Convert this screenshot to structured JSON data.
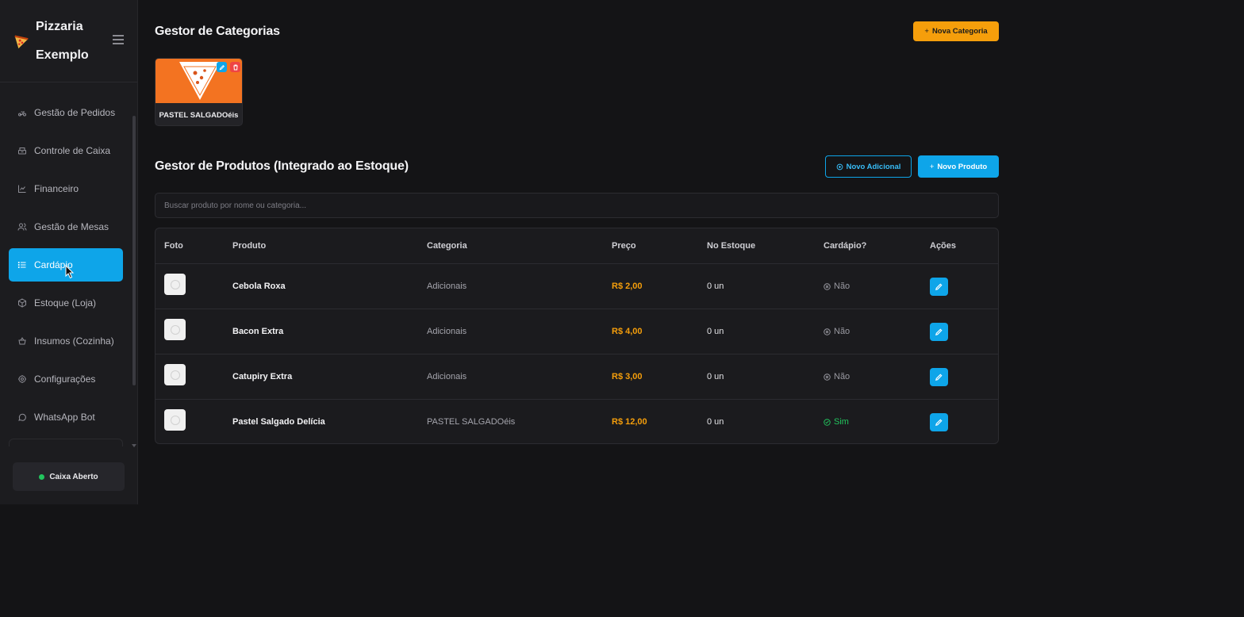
{
  "brand": {
    "name": "Pizzaria Exemplo",
    "logo_icon": "pizza-icon"
  },
  "sidebar": {
    "items": [
      {
        "label": "Gestão de Pedidos",
        "icon": "delivery-icon"
      },
      {
        "label": "Controle de Caixa",
        "icon": "register-icon"
      },
      {
        "label": "Financeiro",
        "icon": "chart-line-icon"
      },
      {
        "label": "Gestão de Mesas",
        "icon": "users-icon"
      },
      {
        "label": "Cardápio",
        "icon": "list-icon",
        "active": true
      },
      {
        "label": "Estoque (Loja)",
        "icon": "box-icon"
      },
      {
        "label": "Insumos (Cozinha)",
        "icon": "basket-icon"
      },
      {
        "label": "Configurações",
        "icon": "gear-icon"
      },
      {
        "label": "WhatsApp Bot",
        "icon": "whatsapp-icon"
      }
    ],
    "status": "Caixa Aberto"
  },
  "categories": {
    "title": "Gestor de Categorias",
    "new_button": "Nova Categoria",
    "items": [
      {
        "name": "PASTEL SALGADOéis"
      }
    ]
  },
  "products": {
    "title": "Gestor de Produtos (Integrado ao Estoque)",
    "new_addon_button": "Novo Adicional",
    "new_product_button": "Novo Produto",
    "search_placeholder": "Buscar produto por nome ou categoria...",
    "columns": [
      "Foto",
      "Produto",
      "Categoria",
      "Preço",
      "No Estoque",
      "Cardápio?",
      "Ações"
    ],
    "rows": [
      {
        "name": "Cebola Roxa",
        "category": "Adicionais",
        "price": "R$ 2,00",
        "stock": "0 un",
        "menu": "Não",
        "on_menu": false
      },
      {
        "name": "Bacon Extra",
        "category": "Adicionais",
        "price": "R$ 4,00",
        "stock": "0 un",
        "menu": "Não",
        "on_menu": false
      },
      {
        "name": "Catupiry Extra",
        "category": "Adicionais",
        "price": "R$ 3,00",
        "stock": "0 un",
        "menu": "Não",
        "on_menu": false
      },
      {
        "name": "Pastel Salgado Delícia",
        "category": "PASTEL SALGADOéis",
        "price": "R$ 12,00",
        "stock": "0 un",
        "menu": "Sim",
        "on_menu": true
      }
    ]
  },
  "colors": {
    "accent": "#0ea5e9",
    "orange": "#f59e0b",
    "success": "#22c55e",
    "danger": "#ef4444"
  }
}
